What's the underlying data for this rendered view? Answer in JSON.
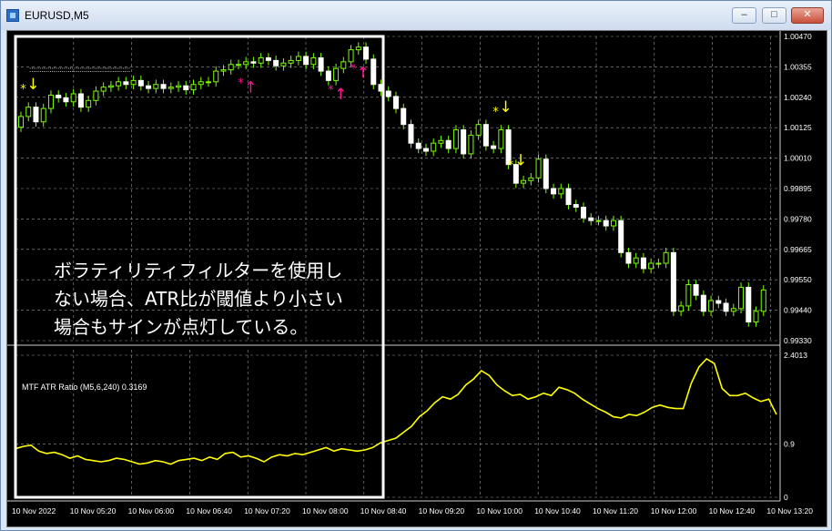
{
  "window": {
    "title": "EURUSD,M5",
    "buttons": [
      "minimize",
      "restore",
      "close"
    ]
  },
  "chart_data": {
    "type": "candlestick",
    "symbol": "EURUSD",
    "timeframe": "M5",
    "price_axis_ticks": [
      "1.00470",
      "1.00355",
      "1.00240",
      "1.00125",
      "1.00010",
      "0.99895",
      "0.99780",
      "0.99665",
      "0.99550",
      "0.99440",
      "0.99330"
    ],
    "indicator": {
      "name": "MTF ATR Ratio",
      "label": "MTF ATR Ratio  (M5,6,240) 0.3169",
      "axis_ticks": [
        "2.4013",
        "0.9",
        "0"
      ],
      "ylim": [
        0,
        2.4013
      ],
      "values": [
        0.82,
        0.86,
        0.88,
        0.78,
        0.74,
        0.76,
        0.72,
        0.66,
        0.7,
        0.64,
        0.62,
        0.6,
        0.62,
        0.66,
        0.64,
        0.6,
        0.56,
        0.58,
        0.62,
        0.6,
        0.56,
        0.62,
        0.64,
        0.66,
        0.62,
        0.68,
        0.64,
        0.74,
        0.76,
        0.68,
        0.7,
        0.66,
        0.6,
        0.68,
        0.72,
        0.7,
        0.74,
        0.72,
        0.76,
        0.8,
        0.84,
        0.78,
        0.82,
        0.8,
        0.78,
        0.8,
        0.84,
        0.92,
        0.96,
        1.0,
        1.1,
        1.2,
        1.36,
        1.46,
        1.6,
        1.7,
        1.66,
        1.74,
        1.9,
        2.0,
        2.14,
        2.06,
        1.9,
        1.8,
        1.72,
        1.74,
        1.66,
        1.7,
        1.76,
        1.72,
        1.86,
        1.82,
        1.76,
        1.66,
        1.58,
        1.5,
        1.44,
        1.36,
        1.34,
        1.4,
        1.38,
        1.44,
        1.52,
        1.56,
        1.52,
        1.5,
        1.5,
        1.92,
        2.2,
        2.34,
        2.26,
        1.84,
        1.72,
        1.72,
        1.76,
        1.68,
        1.62,
        1.66,
        1.4
      ]
    },
    "time_axis_labels": [
      "10 Nov 2022",
      "10 Nov 05:20",
      "10 Nov 06:00",
      "10 Nov 06:40",
      "10 Nov 07:20",
      "10 Nov 08:00",
      "10 Nov 08:40",
      "10 Nov 09:20",
      "10 Nov 10:00",
      "10 Nov 10:40",
      "10 Nov 11:20",
      "10 Nov 12:00",
      "10 Nov 12:40",
      "10 Nov 13:20"
    ],
    "candles_close": [
      1.0017,
      1.00205,
      1.0015,
      1.002,
      1.0025,
      1.0024,
      1.00225,
      1.00255,
      1.00205,
      1.0023,
      1.00265,
      1.0028,
      1.00285,
      1.003,
      1.0029,
      1.00305,
      1.00285,
      1.00275,
      1.0029,
      1.00275,
      1.0028,
      1.00285,
      1.0027,
      1.0029,
      1.003,
      1.003,
      1.0034,
      1.00345,
      1.00365,
      1.00365,
      1.00375,
      1.0037,
      1.0039,
      1.0038,
      1.0036,
      1.0037,
      1.0038,
      1.00395,
      1.00365,
      1.0039,
      1.0034,
      1.00305,
      1.0035,
      1.00375,
      1.0042,
      1.0043,
      1.00385,
      1.0029,
      1.00265,
      1.00245,
      1.002,
      1.0014,
      1.0007,
      1.0005,
      1.0004,
      1.0007,
      1.0008,
      1.0005,
      1.0012,
      1.0003,
      1.001,
      1.0014,
      1.0006,
      1.0005,
      1.0012,
      0.9999,
      0.9992,
      0.9993,
      0.9994,
      1.0001,
      0.999,
      0.9988,
      0.999,
      0.9984,
      0.9983,
      0.9979,
      0.9978,
      0.9978,
      0.9976,
      0.9978,
      0.9966,
      0.9962,
      0.9964,
      0.996,
      0.9962,
      0.9962,
      0.9966,
      0.9944,
      0.9946,
      0.9954,
      0.995,
      0.9944,
      0.9948,
      0.9947,
      0.9944,
      0.9945,
      0.9953,
      0.994,
      0.9944,
      0.9952
    ],
    "candles_open": [
      1.0013,
      1.0017,
      1.00205,
      1.0015,
      1.002,
      1.0025,
      1.0024,
      1.00225,
      1.00255,
      1.00205,
      1.0023,
      1.00265,
      1.0028,
      1.00285,
      1.003,
      1.0029,
      1.00305,
      1.00285,
      1.00275,
      1.0029,
      1.00275,
      1.0028,
      1.00285,
      1.0027,
      1.0029,
      1.003,
      1.003,
      1.0034,
      1.00345,
      1.00365,
      1.00365,
      1.00375,
      1.0037,
      1.0039,
      1.0038,
      1.0036,
      1.0037,
      1.0038,
      1.00395,
      1.00365,
      1.0039,
      1.0034,
      1.00305,
      1.0035,
      1.00375,
      1.0042,
      1.0043,
      1.00385,
      1.0029,
      1.00265,
      1.00245,
      1.002,
      1.0014,
      1.0007,
      1.0005,
      1.0004,
      1.0007,
      1.0008,
      1.0005,
      1.0012,
      1.0003,
      1.001,
      1.0014,
      1.0006,
      1.0005,
      1.0012,
      0.9999,
      0.9992,
      0.9993,
      0.9994,
      1.0001,
      0.999,
      0.9988,
      0.999,
      0.9984,
      0.9983,
      0.9979,
      0.9978,
      0.9978,
      0.9976,
      0.9978,
      0.9966,
      0.9962,
      0.9964,
      0.996,
      0.9962,
      0.9962,
      0.9966,
      0.9944,
      0.9946,
      0.9954,
      0.995,
      0.9944,
      0.9948,
      0.9947,
      0.9944,
      0.9945,
      0.9953,
      0.994,
      0.9944
    ],
    "signals": [
      {
        "index": 1,
        "type": "sell",
        "color": "#ffff00"
      },
      {
        "index": 30,
        "type": "buy",
        "color": "#ff1493"
      },
      {
        "index": 42,
        "type": "buy",
        "color": "#ff1493"
      },
      {
        "index": 45,
        "type": "buy",
        "color": "#ff1493"
      },
      {
        "index": 64,
        "type": "sell",
        "color": "#ffff00"
      },
      {
        "index": 66,
        "type": "sell",
        "color": "#ffff00"
      }
    ],
    "candle_color": "#7cfc00",
    "indicator_color": "#ffff00",
    "grid": true
  },
  "annotation": {
    "text": "ボラティリティフィルターを使用しない場合、ATR比が閾値より小さい場合もサインが点灯している。"
  }
}
